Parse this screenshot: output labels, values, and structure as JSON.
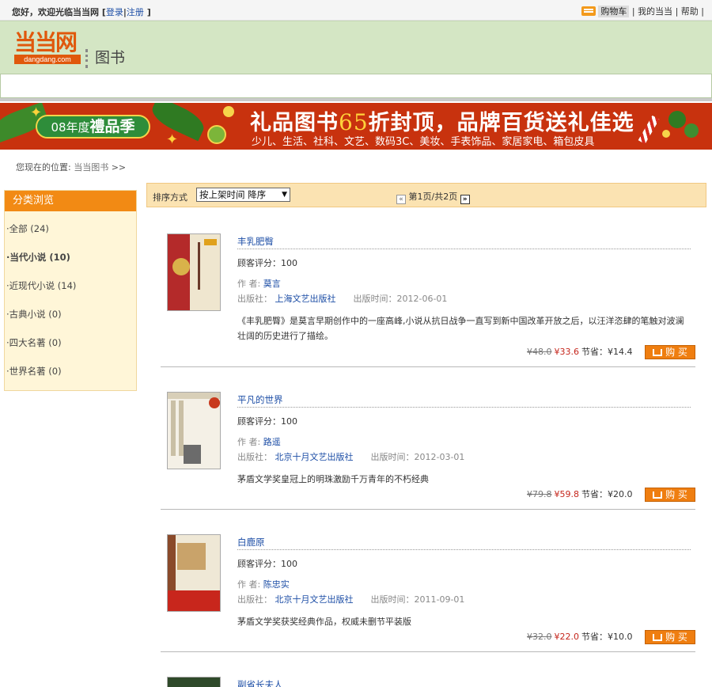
{
  "topbar": {
    "welcome": "您好，欢迎光临当当网 [",
    "login": "登录",
    "sep": "|",
    "register": "注册",
    "close": " ]",
    "cart": "购物车",
    "my": "我的当当",
    "help": "帮助"
  },
  "header": {
    "logo_cn": "当当网",
    "logo_en": "dangdang.com",
    "section": "图书"
  },
  "banner": {
    "pill_year": "08年度",
    "pill_text": "禮品季",
    "headline_a": "礼品图书",
    "headline_num": "65",
    "headline_b": "折封顶，品牌百货送礼佳选",
    "sub": "少儿、生活、社科、文艺、数码3C、美妆、手表饰品、家居家电、箱包皮具"
  },
  "breadcrumb": {
    "label": "您现在的位置:",
    "link": "当当图书",
    "arrow": ">>"
  },
  "sidebar": {
    "title": "分类浏览",
    "items": [
      {
        "label": "·全部 (24)"
      },
      {
        "label": "·当代小说 (10)"
      },
      {
        "label": "·近现代小说 (14)"
      },
      {
        "label": "·古典小说 (0)"
      },
      {
        "label": "·四大名著 (0)"
      },
      {
        "label": "·世界名著 (0)"
      }
    ]
  },
  "sortbar": {
    "label": "排序方式",
    "selected": "按上架时间 降序",
    "prev": "«",
    "page_info": "第1页/共2页",
    "next": "»"
  },
  "labels": {
    "rating": "顾客评分：",
    "author": "作 者:",
    "publisher": "出版社：",
    "pubdate": "出版时间：",
    "save": "节省：",
    "buy": "购 买"
  },
  "products": [
    {
      "name": "丰乳肥臀",
      "rating": "100",
      "author": "莫言",
      "publisher": "上海文艺出版社",
      "pubdate": "2012-06-01",
      "desc": "《丰乳肥臀》是莫言早期创作中的一座高峰,小说从抗日战争一直写到新中国改革开放之后，以汪洋恣肆的笔触对波澜壮阔的历史进行了描绘。",
      "old_price": "¥48.0",
      "price": "¥33.6",
      "save": "¥14.4"
    },
    {
      "name": "平凡的世界",
      "rating": "100",
      "author": "路遥",
      "publisher": "北京十月文艺出版社",
      "pubdate": "2012-03-01",
      "desc": "茅盾文学奖皇冠上的明珠激励千万青年的不朽经典",
      "old_price": "¥79.8",
      "price": "¥59.8",
      "save": "¥20.0"
    },
    {
      "name": "白鹿原",
      "rating": "100",
      "author": "陈忠实",
      "publisher": "北京十月文艺出版社",
      "pubdate": "2011-09-01",
      "desc": "茅盾文学奖获奖经典作品，权威未删节平装版",
      "old_price": "¥32.0",
      "price": "¥22.0",
      "save": "¥10.0"
    },
    {
      "name": "副省长夫人"
    }
  ]
}
